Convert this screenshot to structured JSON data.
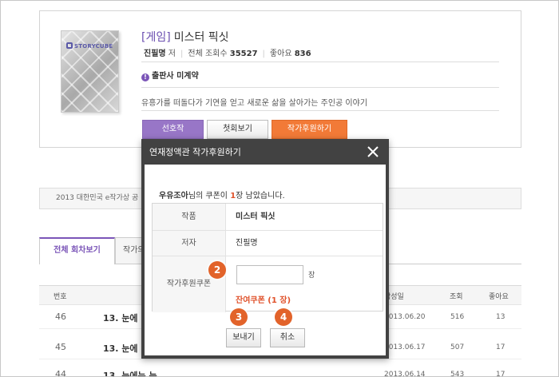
{
  "book": {
    "genre": "[게임]",
    "title": "미스터 픽싯",
    "author": "진필명",
    "author_suffix": "저",
    "views_label": "전체 조회수",
    "views": "35527",
    "likes_label": "좋아요",
    "likes": "836",
    "publisher_notice": "출판사 미계약",
    "synopsis": "유흥가를 떠돌다가 기연을 얻고 새로운 삶을 살아가는 주인공 이야기",
    "cover_brand": "STORYCUBE"
  },
  "actions": {
    "prefer": "선호작",
    "first_episode": "첫회보기",
    "support": "작가후원하기"
  },
  "announcement": "2013 대한민국 e작가상 공",
  "tabs": {
    "all_episodes": "전체 회차보기",
    "second": "작가의"
  },
  "table": {
    "headers": {
      "no": "번호",
      "date": "작성일",
      "views": "조회",
      "likes": "좋아요"
    },
    "rows": [
      {
        "no": "46",
        "title": "13. 눈에",
        "date": "2013.06.20",
        "views": "516",
        "likes": "13"
      },
      {
        "no": "45",
        "title": "13. 눈에",
        "date": "2013.06.17",
        "views": "507",
        "likes": "17"
      },
      {
        "no": "44",
        "title": "13. 눈에는 눈",
        "date": "2013.06.14",
        "views": "543",
        "likes": "17"
      }
    ]
  },
  "modal": {
    "title": "연재정액관 작가후원하기",
    "notice_user": "우유조아",
    "notice_pre": "님의 쿠폰이",
    "notice_count": "1",
    "notice_post": "장 남았습니다.",
    "work_label": "작품",
    "work_value": "미스터 픽싯",
    "author_label": "저자",
    "author_value": "진필명",
    "coupon_label": "작가후원쿠폰",
    "coupon_value": "",
    "coupon_unit": "장",
    "remaining": "잔여쿠폰 (1 장)",
    "send": "보내기",
    "cancel": "취소"
  },
  "badges": {
    "b2": "2",
    "b3": "3",
    "b4": "4"
  },
  "colors": {
    "accent": "#7b55b8",
    "orange": "#f27a37",
    "badge": "#e2632a",
    "modal_header": "#424242"
  }
}
